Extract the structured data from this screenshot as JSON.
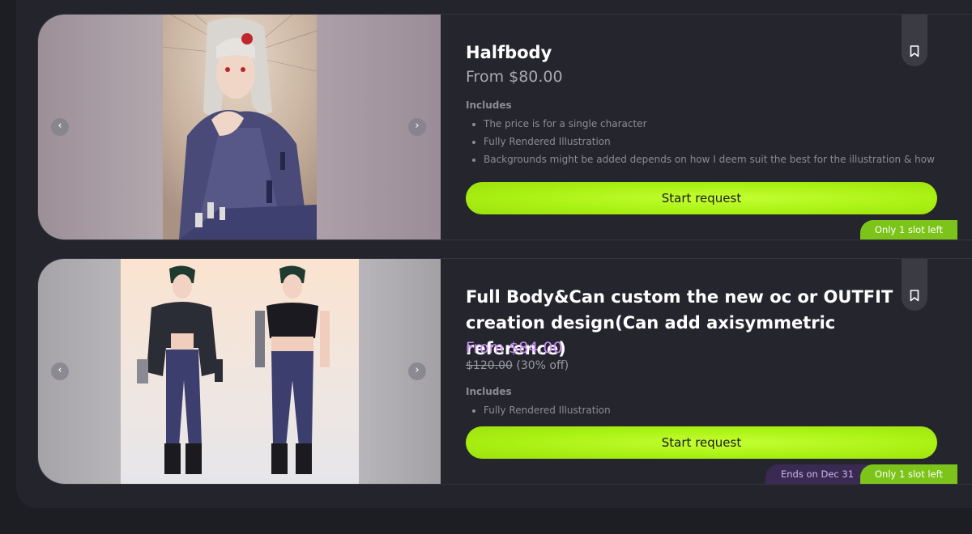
{
  "listings": [
    {
      "title": "Halfbody",
      "price": "From $80.00",
      "includes_label": "Includes",
      "includes": [
        "The price is for a single character",
        "Fully Rendered Illustration",
        "Backgrounds might be added depends on how I deem suit the best for the illustration & how"
      ],
      "cta_label": "Start request",
      "slots_badge": "Only 1 slot left",
      "nav_prev": "‹",
      "nav_next": "›"
    },
    {
      "title": "Full Body&Can custom the new oc or OUTFIT creation design(Can add axisymmetric reference)",
      "price": "From $84.00",
      "old_price": "$120.00",
      "discount": "(30% off)",
      "includes_label": "Includes",
      "includes": [
        "Fully Rendered Illustration"
      ],
      "cta_label": "Start request",
      "slots_badge": "Only 1 slot left",
      "ends_badge": "Ends on Dec 31",
      "nav_prev": "‹",
      "nav_next": "›"
    }
  ],
  "icons": {
    "bookmark": "bookmark-icon",
    "prev": "chevron-left-icon",
    "next": "chevron-right-icon"
  },
  "colors": {
    "background": "#1d1d24",
    "card": "#25252e",
    "cta": "#b4f51f",
    "discount_price": "#c78df0",
    "slot_badge": "#7cc41a",
    "ends_badge": "#3a2a52"
  }
}
